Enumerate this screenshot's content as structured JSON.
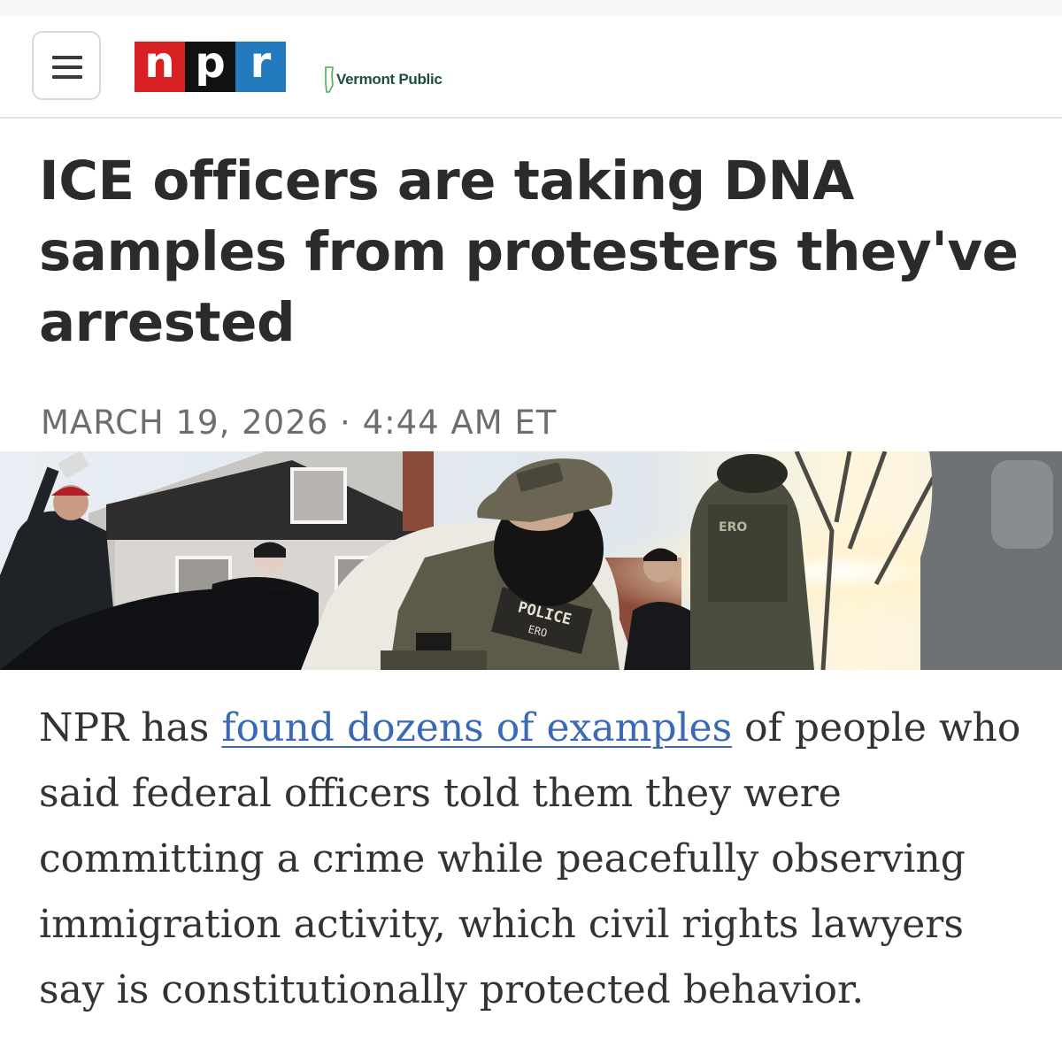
{
  "header": {
    "menu_icon": "hamburger-menu-icon",
    "npr_logo": {
      "letters": [
        "n",
        "p",
        "r"
      ],
      "colors": [
        "#d62021",
        "#111111",
        "#237bbd"
      ]
    },
    "station_name": "Vermont Public",
    "station_color": "#1d4f3a"
  },
  "article": {
    "headline": "ICE officers are taking DNA samples from protesters they've arrested",
    "dateline": "MARCH 19, 2026 · 4:44 AM ET",
    "photo": {
      "badge_text_1": "POLICE",
      "badge_text_2": "ERO",
      "vest_text": "ERO"
    },
    "lede_before": "NPR has ",
    "lede_link": "found dozens of examples",
    "lede_after": " of people who said federal officers told them they were committing a crime while peacefully observing immigration activity, which civil rights lawyers say is constitutionally protected behavior.",
    "link_color": "#3a6ab5"
  }
}
